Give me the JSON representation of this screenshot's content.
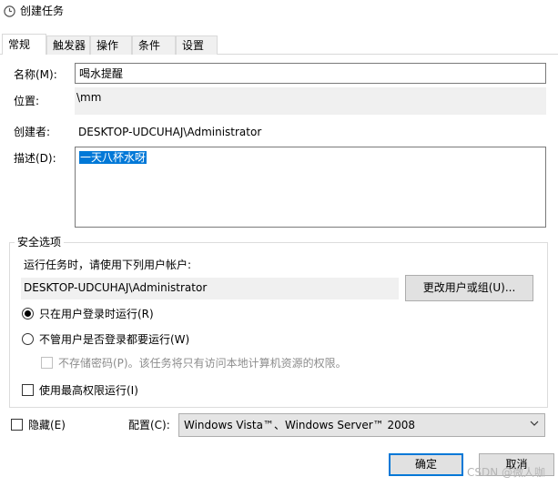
{
  "window": {
    "title": "创建任务",
    "icon": "task-clock-icon"
  },
  "tabs": [
    {
      "label": "常规",
      "active": true
    },
    {
      "label": "触发器"
    },
    {
      "label": "操作"
    },
    {
      "label": "条件"
    },
    {
      "label": "设置"
    }
  ],
  "general": {
    "name_label": "名称(M):",
    "name_value": "喝水提醒",
    "location_label": "位置:",
    "location_value": "\\mm",
    "author_label": "创建者:",
    "author_value": "DESKTOP-UDCUHAJ\\Administrator",
    "description_label": "描述(D):",
    "description_value": "一天八杯水呀"
  },
  "security": {
    "group_title": "安全选项",
    "run_as_prompt": "运行任务时，请使用下列用户帐户:",
    "user_account": "DESKTOP-UDCUHAJ\\Administrator",
    "change_user_button": "更改用户或组(U)...",
    "radio_logged_on": "只在用户登录时运行(R)",
    "radio_logged_on_selected": true,
    "radio_whether_logged": "不管用户是否登录都要运行(W)",
    "do_not_store_password": "不存储密码(P)。该任务将只有访问本地计算机资源的权限。",
    "highest_privileges": "使用最高权限运行(I)"
  },
  "bottom": {
    "hidden_label": "隐藏(E)",
    "configure_label": "配置(C):",
    "configure_value": "Windows Vista™、Windows Server™ 2008",
    "ok_button": "确定",
    "cancel_button": "取消"
  },
  "watermark": "CSDN @微人咖",
  "colors": {
    "accent": "#0078d7",
    "selection": "#0078d7",
    "disabled_text": "#8c8c8c"
  }
}
